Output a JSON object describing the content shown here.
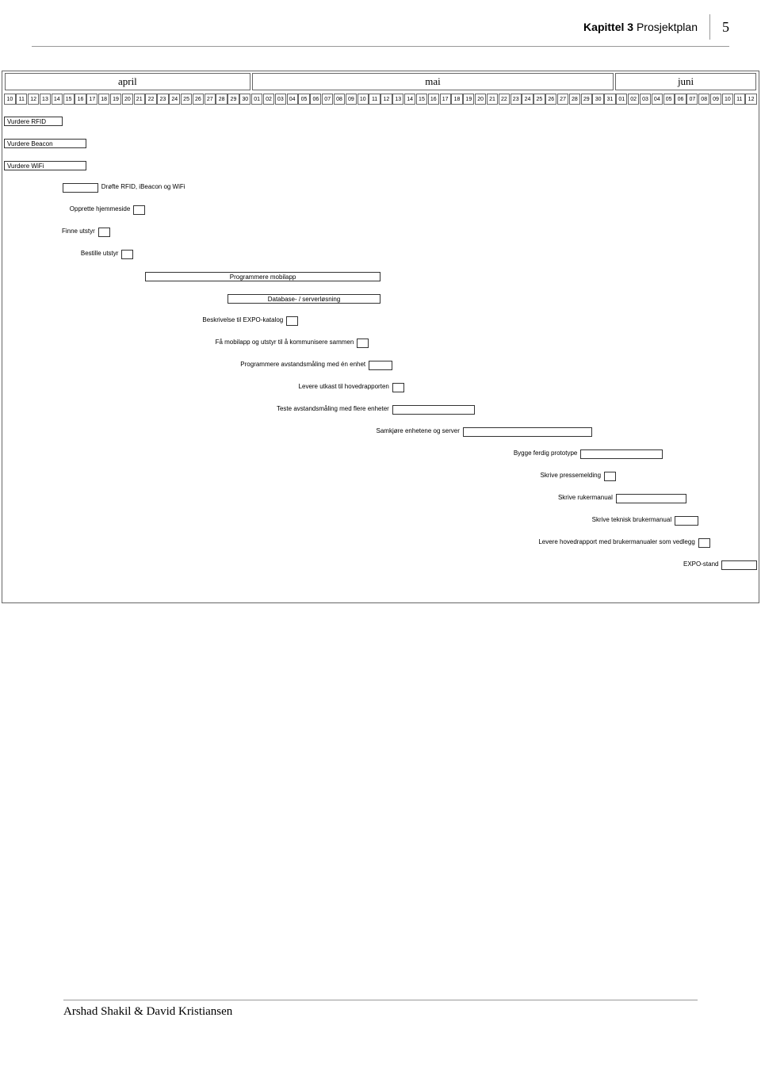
{
  "header": {
    "chapter_bold": "Kapittel 3",
    "chapter_rest": " Prosjektplan",
    "page": "5"
  },
  "footer": {
    "authors": "Arshad Shakil  & David Kristiansen"
  },
  "chart_data": {
    "type": "gantt",
    "months": [
      {
        "name": "april",
        "span": 21
      },
      {
        "name": "mai",
        "span": 31
      },
      {
        "name": "juni",
        "span": 12
      }
    ],
    "days": [
      "10",
      "11",
      "12",
      "13",
      "14",
      "15",
      "16",
      "17",
      "18",
      "19",
      "20",
      "21",
      "22",
      "23",
      "24",
      "25",
      "26",
      "27",
      "28",
      "29",
      "30",
      "01",
      "02",
      "03",
      "04",
      "05",
      "06",
      "07",
      "08",
      "09",
      "10",
      "11",
      "12",
      "13",
      "14",
      "15",
      "16",
      "17",
      "18",
      "19",
      "20",
      "21",
      "22",
      "23",
      "24",
      "25",
      "26",
      "27",
      "28",
      "29",
      "30",
      "31",
      "01",
      "02",
      "03",
      "04",
      "05",
      "06",
      "07",
      "08",
      "09",
      "10",
      "11",
      "12"
    ],
    "tasks": [
      {
        "label": "Vurdere RFID",
        "start": 0,
        "end": 5,
        "label_pos": "inside"
      },
      {
        "label": "Vurdere Beacon",
        "start": 0,
        "end": 7,
        "label_pos": "inside"
      },
      {
        "label": "Vurdere WiFi",
        "start": 0,
        "end": 7,
        "label_pos": "inside"
      },
      {
        "label": "Drøfte RFID, iBeacon og WiFi",
        "start": 5,
        "end": 8,
        "label_pos": "right"
      },
      {
        "label": "Opprette hjemmeside",
        "start": 11,
        "end": 12,
        "label_pos": "left"
      },
      {
        "label": "Finne utstyr",
        "start": 8,
        "end": 9,
        "label_pos": "left"
      },
      {
        "label": "Bestille utstyr",
        "start": 10,
        "end": 11,
        "label_pos": "left"
      },
      {
        "label": "Programmere mobilapp",
        "start": 12,
        "end": 32,
        "label_pos": "inside-center"
      },
      {
        "label": "Database- / serverløsning",
        "start": 19,
        "end": 32,
        "label_pos": "inside-center"
      },
      {
        "label": "Beskrivelse til EXPO-katalog",
        "start": 24,
        "end": 25,
        "label_pos": "left"
      },
      {
        "label": "Få mobilapp og utstyr til å kommunisere sammen",
        "start": 30,
        "end": 31,
        "label_pos": "left"
      },
      {
        "label": "Programmere avstandsmåling med én enhet",
        "start": 31,
        "end": 33,
        "label_pos": "left"
      },
      {
        "label": "Levere utkast til hovedrapporten",
        "start": 33,
        "end": 34,
        "label_pos": "left"
      },
      {
        "label": "Teste avstandsmåling med flere enheter",
        "start": 33,
        "end": 40,
        "label_pos": "left"
      },
      {
        "label": "Samkjøre enhetene og server",
        "start": 39,
        "end": 50,
        "label_pos": "left"
      },
      {
        "label": "Bygge ferdig prototype",
        "start": 49,
        "end": 56,
        "label_pos": "left"
      },
      {
        "label": "Skrive pressemelding",
        "start": 51,
        "end": 52,
        "label_pos": "left"
      },
      {
        "label": "Skrive rukermanual",
        "start": 52,
        "end": 58,
        "label_pos": "left"
      },
      {
        "label": "Skrive teknisk brukermanual",
        "start": 57,
        "end": 59,
        "label_pos": "left"
      },
      {
        "label": "Levere hovedrapport med brukermanualer som vedlegg",
        "start": 59,
        "end": 60,
        "label_pos": "left"
      },
      {
        "label": "EXPO-stand",
        "start": 61,
        "end": 64,
        "label_pos": "left"
      }
    ]
  }
}
